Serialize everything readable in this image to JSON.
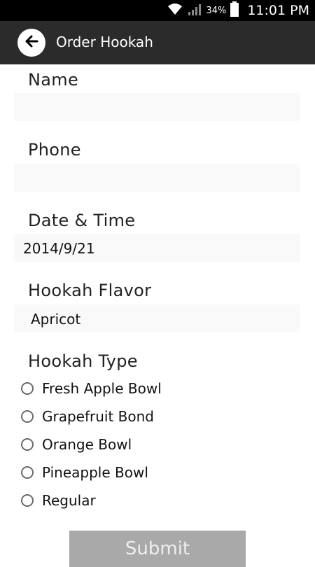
{
  "status_bar": {
    "battery_percent": "34%",
    "time": "11:01 PM",
    "icons": [
      "wifi-icon",
      "signal-icon",
      "battery-icon"
    ]
  },
  "app_bar": {
    "back_icon": "back-arrow-icon",
    "title": "Order Hookah"
  },
  "form": {
    "name": {
      "label": "Name",
      "value": ""
    },
    "phone": {
      "label": "Phone",
      "value": ""
    },
    "datetime": {
      "label": "Date & Time",
      "value": "2014/9/21"
    },
    "flavor": {
      "label": "Hookah Flavor",
      "value": "Apricot"
    },
    "type": {
      "label": "Hookah Type",
      "options": [
        {
          "label": "Fresh Apple Bowl",
          "selected": false
        },
        {
          "label": "Grapefruit Bond",
          "selected": false
        },
        {
          "label": "Orange Bowl",
          "selected": false
        },
        {
          "label": "Pineapple Bowl",
          "selected": false
        },
        {
          "label": "Regular",
          "selected": false
        }
      ]
    },
    "submit_label": "Submit"
  },
  "colors": {
    "status_bar_bg": "#000000",
    "app_bar_bg": "#2b2b2b",
    "field_bg": "#f9f9f9",
    "submit_bg": "#a9a9a9"
  }
}
